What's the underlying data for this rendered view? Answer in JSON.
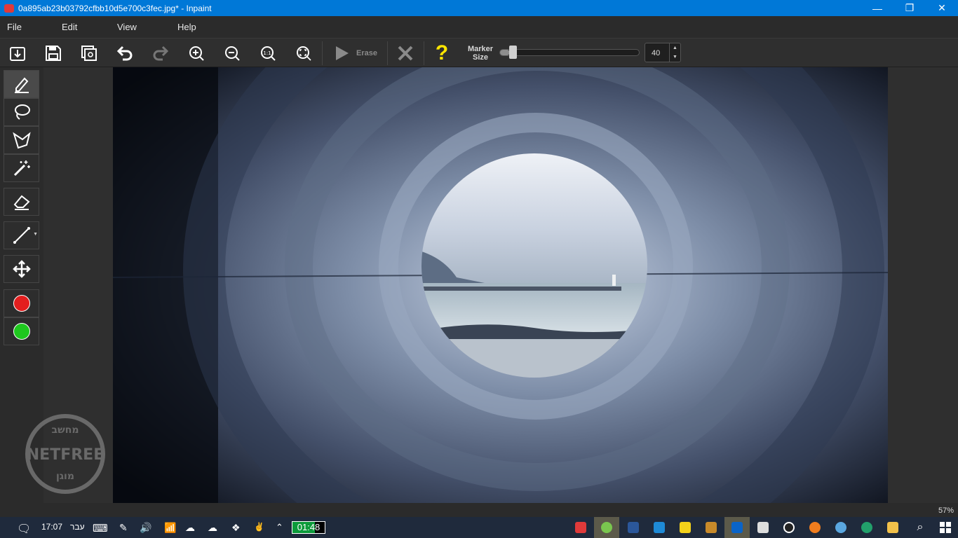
{
  "window": {
    "title": "0a895ab23b03792cfbb10d5e700c3fec.jpg* - Inpaint",
    "minimize_glyph": "—",
    "restore_glyph": "❐",
    "close_glyph": "✕"
  },
  "menu": {
    "file": "File",
    "edit": "Edit",
    "view": "View",
    "help": "Help"
  },
  "toolbar": {
    "erase_label": "Erase",
    "marker_label_line1": "Marker",
    "marker_label_line2": "Size",
    "marker_size": "40",
    "marker_size_fraction": 0.07,
    "help_glyph": "?"
  },
  "colors": {
    "accent": "#0078d7",
    "red_marker": "#e31e1e",
    "green_marker": "#1ec81e",
    "help_yellow": "#ffe600",
    "timer_fill": "#0c9a3a"
  },
  "status": {
    "zoom": "57%"
  },
  "taskbar": {
    "time": "17:07",
    "language": "עבר",
    "timer": "01:48",
    "timer_fraction": 0.7
  },
  "watermark": {
    "top_text": "מחשב",
    "main_text": "NETFREE",
    "bottom_text": "מוגן"
  },
  "icons": {
    "open": "open-icon",
    "save": "save-icon",
    "save_as": "save-as-icon",
    "undo": "undo-icon",
    "redo": "redo-icon",
    "zoom_in": "zoom-in-icon",
    "zoom_out": "zoom-out-icon",
    "actual_size": "actual-size-icon",
    "fit": "fit-icon",
    "erase": "play-icon",
    "cancel": "x-icon",
    "help": "help-icon",
    "marker": "marker-icon",
    "lasso": "lasso-icon",
    "polygon": "polygon-lasso-icon",
    "magic": "magic-wand-icon",
    "eraser": "eraser-icon",
    "line": "line-icon",
    "move": "move-icon"
  }
}
